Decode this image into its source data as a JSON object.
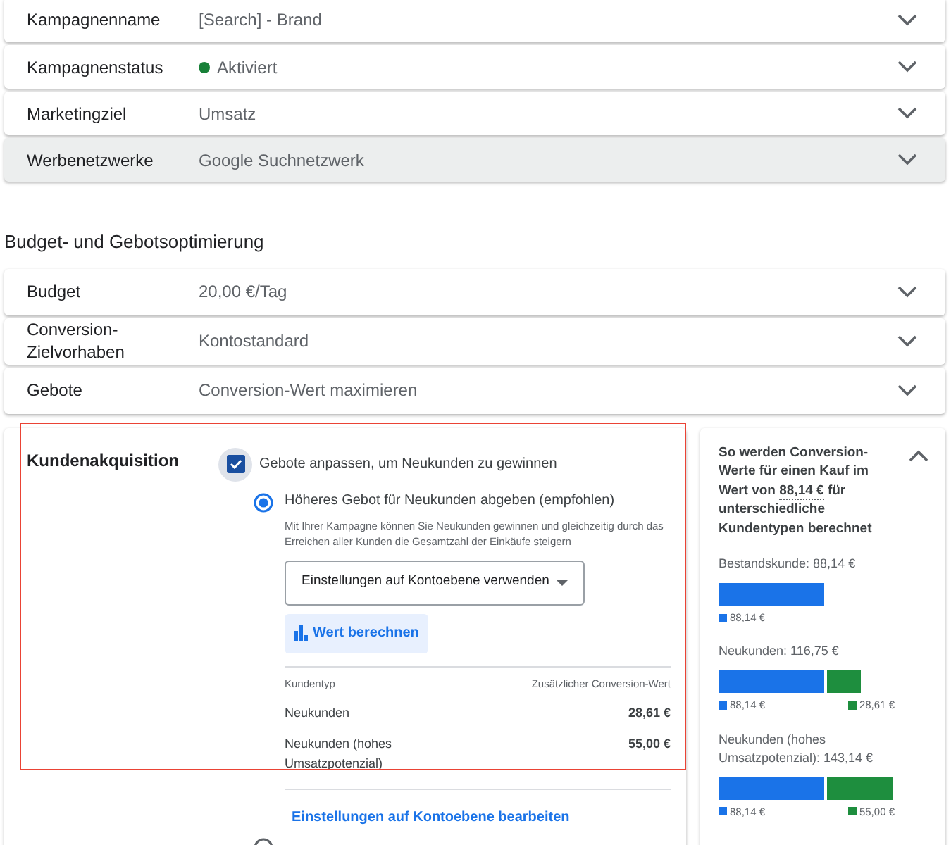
{
  "settings_rows": [
    {
      "label": "Kampagnenname",
      "value": "[Search] - Brand",
      "highlighted": false
    },
    {
      "label": "Kampagnenstatus",
      "value": "Aktiviert",
      "color": "#188038",
      "highlighted": false
    },
    {
      "label": "Marketingziel",
      "value": "Umsatz",
      "highlighted": false
    },
    {
      "label": "Werbenetzwerke",
      "value": "Google Suchnetzwerk",
      "highlighted": true
    }
  ],
  "section_title": "Budget- und Gebotsoptimierung",
  "budget_rows": [
    {
      "label": "Budget",
      "value": "20,00 €/Tag",
      "highlighted": false
    },
    {
      "label": "Conversion-Zielvorhaben",
      "value": "Kontostandard",
      "highlighted": false
    },
    {
      "label": "Gebote",
      "value": "Conversion-Wert maximieren",
      "highlighted": false
    }
  ],
  "acquisition": {
    "label": "Kundenakquisition",
    "checkbox": {
      "label": "Gebote anpassen, um Neukunden zu gewinnen",
      "checked": true
    },
    "options": [
      {
        "label": "Höheres Gebot für Neukunden abgeben (empfohlen)",
        "selected": true,
        "description": "Mit Ihrer Kampagne können Sie Neukunden gewinnen und gleichzeitig durch das Erreichen aller Kunden die Gesamtzahl der Einkäufe steigern",
        "dropdown": "Einstellungen auf Kontoebene verwenden",
        "button": "Wert berechnen",
        "table": {
          "columns": [
            "Kundentyp",
            "Zusätzlicher Conversion-Wert"
          ],
          "rows": [
            [
              "Neukunden",
              "28,61 €"
            ],
            [
              "Neukunden (hohes Umsatzpotenzial)",
              "55,00 €"
            ]
          ]
        },
        "link": "Einstellungen auf Kontoebene bearbeiten"
      },
      {
        "selected": false
      }
    ]
  },
  "value_panel": {
    "heading_before": "So werden Conversion-Werte für einen Kauf im Wert von",
    "heading_amount": "88,14 €",
    "heading_after": "für unterschiedliche Kundentypen berechnet",
    "expanded": true,
    "groups": [
      {
        "label": "Bestandskunde: 88,14 €",
        "segments": [
          {
            "value": "88,14 €",
            "color": "#1a73e8"
          }
        ]
      },
      {
        "label": "Neukunden: 116,75 €",
        "segments": [
          {
            "value": "88,14 €",
            "color": "#1a73e8"
          },
          {
            "value": "28,61 €",
            "color": "#1e8e3e"
          }
        ]
      },
      {
        "label": "Neukunden (hohes Umsatzpotenzial): 143,14 €",
        "segments": [
          {
            "value": "88,14 €",
            "color": "#1a73e8"
          },
          {
            "value": "55,00 €",
            "color": "#1e8e3e"
          }
        ]
      }
    ]
  }
}
